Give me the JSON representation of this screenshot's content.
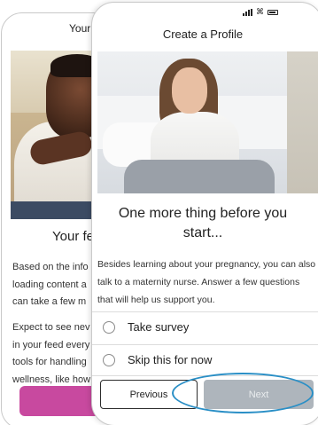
{
  "back_screen": {
    "title": "Your",
    "heading": "Your fe",
    "paragraph1": [
      "Based on the info",
      "loading content a",
      "can take a few m"
    ],
    "paragraph2": [
      "Expect to see nev",
      "in your feed every",
      "tools for handling",
      "wellness, like how"
    ],
    "button_color": "#c8499f"
  },
  "front_screen": {
    "title": "Create a Profile",
    "heading_line1": "One more thing before you",
    "heading_line2": "start...",
    "description": "Besides learning about your pregnancy, you can also talk to a maternity nurse. Answer a few questions that will help us support you.",
    "options": [
      {
        "label": "Take survey",
        "selected": false
      },
      {
        "label": "Skip this for now",
        "selected": false
      }
    ],
    "previous_label": "Previous",
    "next_label": "Next",
    "next_enabled": false
  },
  "colors": {
    "highlight": "#2a8fc6",
    "next_disabled": "#aeb5bc"
  },
  "icons": [
    "signal-icon",
    "wifi-icon",
    "battery-icon"
  ]
}
